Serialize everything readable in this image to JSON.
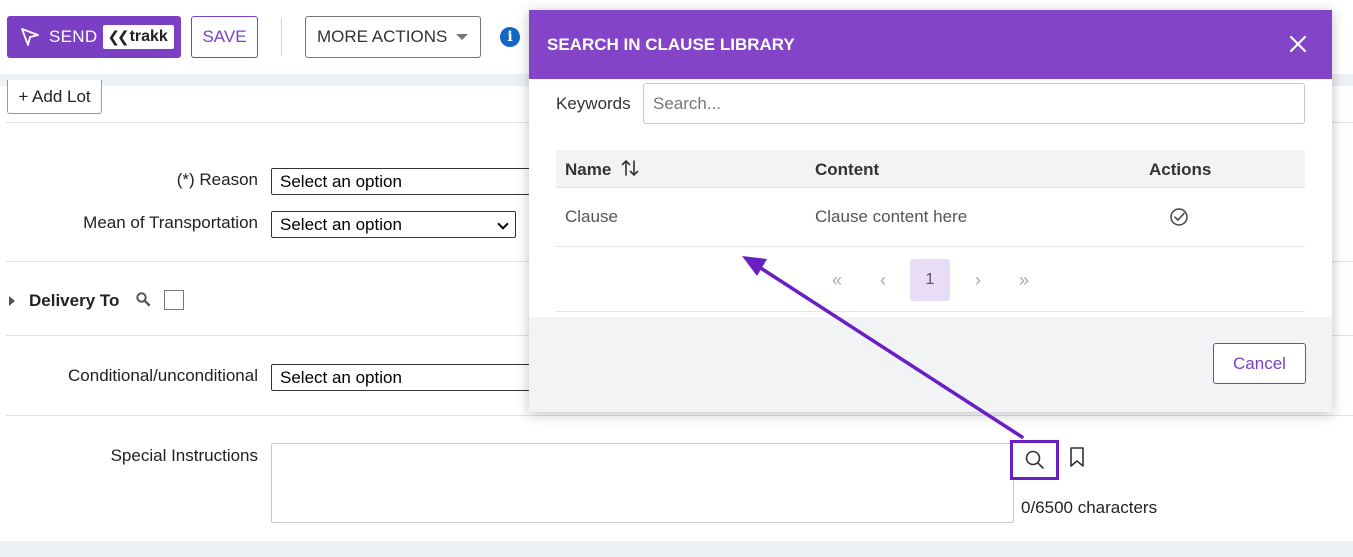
{
  "toolbar": {
    "send_label": "SEND",
    "brand_name": "trakk",
    "save_label": "SAVE",
    "more_actions_label": "MORE ACTIONS",
    "info_glyph": "i"
  },
  "form": {
    "add_lot_label": "+ Add Lot",
    "reason": {
      "label": "(*) Reason",
      "value": "Select an option"
    },
    "transport": {
      "label": "Mean of Transportation",
      "value": "Select an option"
    },
    "delivery_to": {
      "label": "Delivery To"
    },
    "conditional": {
      "label": "Conditional/unconditional",
      "value": "Select an option"
    },
    "special_instructions": {
      "label": "Special Instructions",
      "value": "",
      "char_count": "0/6500 characters"
    }
  },
  "modal": {
    "title": "SEARCH IN CLAUSE LIBRARY",
    "keywords_label": "Keywords",
    "search_placeholder": "Search...",
    "columns": [
      "Name",
      "Content",
      "Actions"
    ],
    "rows": [
      {
        "name": "Clause",
        "content": "Clause content here"
      }
    ],
    "pagination": {
      "first": "«",
      "prev": "‹",
      "current": "1",
      "next": "›",
      "last": "»"
    },
    "cancel_label": "Cancel"
  },
  "colors": {
    "brand_purple": "#7b3fc4",
    "header_purple": "#8444c8",
    "highlight_purple": "#6a1fc5",
    "info_blue": "#1466c7"
  }
}
